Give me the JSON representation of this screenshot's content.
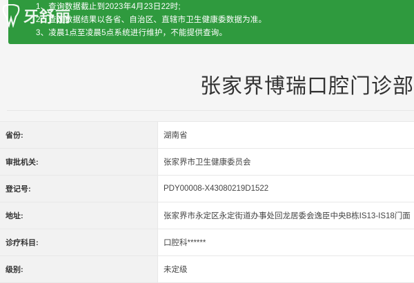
{
  "notice": {
    "lines": [
      "1、查询数据截止到2023年4月23日22时;",
      "2、查询数据结果以各省、自治区、直辖市卫生健康委数据为准。",
      "3、凌晨1点至凌晨5点系统进行维护，不能提供查询。"
    ],
    "watermark": "牙舒丽",
    "background_color": "#2f9a3e"
  },
  "title": "张家界博瑞口腔门诊部",
  "rows": [
    {
      "label": "省份:",
      "value": "湖南省"
    },
    {
      "label": "审批机关:",
      "value": "张家界市卫生健康委员会"
    },
    {
      "label": "登记号:",
      "value": "PDY00008-X43080219D1522"
    },
    {
      "label": "地址:",
      "value": "张家界市永定区永定街道办事处回龙居委会逸臣中央B栋IS13-IS18门面"
    },
    {
      "label": "诊疗科目:",
      "value": "口腔科******"
    },
    {
      "label": "级别:",
      "value": "未定级"
    }
  ]
}
